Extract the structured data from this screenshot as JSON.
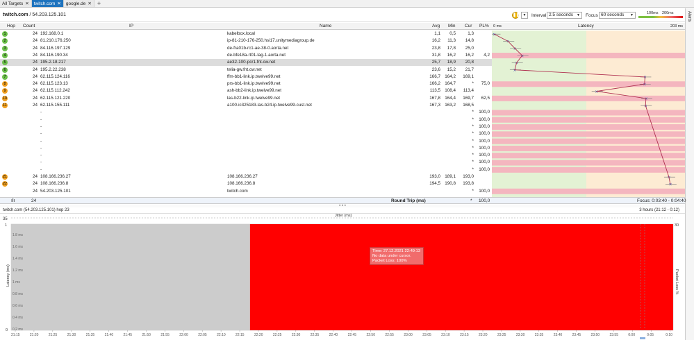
{
  "tabs": [
    {
      "label": "All Targets",
      "active": false,
      "closable": true
    },
    {
      "label": "twitch.com",
      "active": true,
      "closable": true
    },
    {
      "label": "google.de",
      "active": false,
      "closable": true
    }
  ],
  "header": {
    "target_name": "twitch.com",
    "target_ip": "54.203.125.101",
    "interval_label": "Interval",
    "interval_value": "2.5 seconds",
    "focus_label": "Focus",
    "focus_value": "60 seconds",
    "legend": {
      "low": "100ms",
      "high": "200ms"
    },
    "alerts_label": "Alerts"
  },
  "columns": {
    "hop": "Hop",
    "count": "Count",
    "ip": "IP",
    "name": "Name",
    "avg": "Avg",
    "min": "Min",
    "cur": "Cur",
    "pl": "PL%",
    "latency": "Latency",
    "scale_min": "0 ms",
    "scale_max": "203 ms"
  },
  "rows": [
    {
      "hop": "1",
      "count": "24",
      "ip": "192.168.0.1",
      "name": "kabelbox.local",
      "avg": "1,1",
      "min": "0,5",
      "cur": "1,3",
      "pl": "",
      "lat": 1.1
    },
    {
      "hop": "2",
      "count": "24",
      "ip": "81.210.176.250",
      "name": "ip-81-210-176-250.hsi17.unitymediagroup.de",
      "avg": "16,2",
      "min": "11,3",
      "cur": "14,8",
      "pl": "",
      "lat": 16.2
    },
    {
      "hop": "3",
      "count": "24",
      "ip": "84.116.197.129",
      "name": "de-fra01b-rc1-ae-38-0.aorta.net",
      "avg": "23,8",
      "min": "17,8",
      "cur": "25,0",
      "pl": "",
      "lat": 23.8
    },
    {
      "hop": "4",
      "count": "24",
      "ip": "84.116.190.34",
      "name": "de-bfe18a-rt01-lag-1.aorta.net",
      "avg": "31,8",
      "min": "16,2",
      "cur": "16,2",
      "pl": "4,2",
      "lat": 31.8
    },
    {
      "hop": "5",
      "count": "24",
      "ip": "195.2.18.217",
      "name": "ae32-100-pcr1.fnt.cw.net",
      "avg": "25,7",
      "min": "18,9",
      "cur": "20,8",
      "pl": "",
      "lat": 25.7,
      "selected": true
    },
    {
      "hop": "6",
      "count": "24",
      "ip": "195.2.22.238",
      "name": "telia-gw.fnt.cw.net",
      "avg": "23,6",
      "min": "15,2",
      "cur": "21,7",
      "pl": "",
      "lat": 23.6
    },
    {
      "hop": "7",
      "count": "24",
      "ip": "62.115.124.116",
      "name": "ffm-bb1-link.ip.twelve99.net",
      "avg": "166,7",
      "min": "164,2",
      "cur": "169,1",
      "pl": "",
      "lat": 166.7
    },
    {
      "hop": "8",
      "count": "24",
      "ip": "62.115.123.13",
      "name": "prs-bb1-link.ip.twelve99.net",
      "avg": "166,2",
      "min": "164,7",
      "cur": "*",
      "pl": "75,0",
      "lat": 166.2
    },
    {
      "hop": "9",
      "count": "24",
      "ip": "62.115.112.242",
      "name": "ash-bb2-link.ip.twelve99.net",
      "avg": "113,5",
      "min": "108,4",
      "cur": "113,4",
      "pl": "",
      "lat": 113.5
    },
    {
      "hop": "10",
      "count": "24",
      "ip": "62.115.121.220",
      "name": "las-b22-link.ip.twelve99.net",
      "avg": "167,8",
      "min": "164,4",
      "cur": "169,7",
      "pl": "62,5",
      "lat": 167.8
    },
    {
      "hop": "11",
      "count": "24",
      "ip": "62.115.155.111",
      "name": "a100-ic325183-las-b24.ip.twelve99-cust.net",
      "avg": "167,3",
      "min": "163,2",
      "cur": "168,5",
      "pl": "",
      "lat": 167.3
    },
    {
      "hop": "",
      "count": "",
      "ip": "-",
      "name": "",
      "avg": "",
      "min": "",
      "cur": "*",
      "pl": "100,0"
    },
    {
      "hop": "",
      "count": "",
      "ip": "-",
      "name": "",
      "avg": "",
      "min": "",
      "cur": "*",
      "pl": "100,0"
    },
    {
      "hop": "",
      "count": "",
      "ip": "-",
      "name": "",
      "avg": "",
      "min": "",
      "cur": "*",
      "pl": "100,0"
    },
    {
      "hop": "",
      "count": "",
      "ip": "-",
      "name": "",
      "avg": "",
      "min": "",
      "cur": "*",
      "pl": "100,0"
    },
    {
      "hop": "",
      "count": "",
      "ip": "-",
      "name": "",
      "avg": "",
      "min": "",
      "cur": "*",
      "pl": "100,0"
    },
    {
      "hop": "",
      "count": "",
      "ip": "-",
      "name": "",
      "avg": "",
      "min": "",
      "cur": "*",
      "pl": "100,0"
    },
    {
      "hop": "",
      "count": "",
      "ip": "-",
      "name": "",
      "avg": "",
      "min": "",
      "cur": "*",
      "pl": "100,0"
    },
    {
      "hop": "",
      "count": "",
      "ip": "-",
      "name": "",
      "avg": "",
      "min": "",
      "cur": "*",
      "pl": "100,0"
    },
    {
      "hop": "",
      "count": "",
      "ip": "-",
      "name": "",
      "avg": "",
      "min": "",
      "cur": "*",
      "pl": "100,0"
    },
    {
      "hop": "21",
      "count": "24",
      "ip": "108.166.236.27",
      "name": "108.166.236.27",
      "avg": "193,0",
      "min": "189,1",
      "cur": "193,0",
      "pl": "",
      "lat": 193.0
    },
    {
      "hop": "22",
      "count": "24",
      "ip": "108.166.236.8",
      "name": "108.166.236.8",
      "avg": "194,5",
      "min": "190,8",
      "cur": "193,8",
      "pl": "",
      "lat": 194.5
    },
    {
      "hop": "",
      "count": "24",
      "ip": "54.203.125.101",
      "name": "twitch.com",
      "avg": "",
      "min": "",
      "cur": "*",
      "pl": "100,0"
    }
  ],
  "summary": {
    "count": "24",
    "label": "Round Trip (ms)",
    "cur": "*",
    "pl": "100,0",
    "focus": "Focus: 0:03:40 - 0:04:40"
  },
  "timeline": {
    "title": "twitch.com (54.203.125.101) hop 23",
    "range": "3 hours (21:12 - 0:12)",
    "jitter_label": "Jitter (ms)",
    "jitter_max": "35",
    "y_label": "Latency (ms)",
    "y2_label": "Packet Loss %",
    "y_ticks": [
      "1.8 ms",
      "1.6 ms",
      "1.4 ms",
      "1.2 ms",
      "1 ms",
      "0.8 ms",
      "0.6 ms",
      "0.4 ms",
      "0.2 ms"
    ],
    "y_top": "1",
    "y_bottom": "0",
    "y2_top": "30",
    "x_ticks": [
      "21:15",
      "21:20",
      "21:25",
      "21:30",
      "21:35",
      "21:40",
      "21:45",
      "21:50",
      "21:55",
      "22:00",
      "22:05",
      "22:10",
      "22:15",
      "22:20",
      "22:25",
      "22:30",
      "22:35",
      "22:40",
      "22:45",
      "22:50",
      "22:55",
      "23:00",
      "23:05",
      "23:10",
      "23:15",
      "23:20",
      "23:25",
      "23:30",
      "23:35",
      "23:40",
      "23:45",
      "23:50",
      "23:55",
      "0:00",
      "0:05",
      "0:10"
    ],
    "loss_start": "22:20",
    "tooltip": {
      "time": "Time: 27.12.2021 22:49:13",
      "line2": "No data under cursor.",
      "line3": "Packet Loss: 100%"
    }
  },
  "colors": {
    "green_zone": "#e3f2d4",
    "orange_zone": "#fdebd3",
    "loss_red": "#f4b6bf",
    "graph_red": "#ff0000",
    "graph_gray": "#cccccc",
    "line": "#b03050"
  }
}
